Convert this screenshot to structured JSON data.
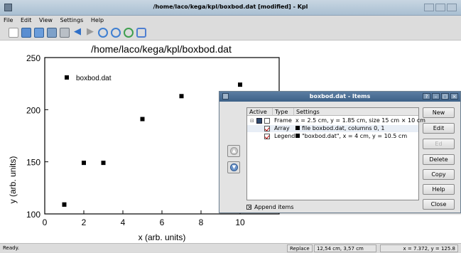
{
  "window": {
    "title": "/home/laco/kega/kpl/boxbod.dat [modified] - Kpl"
  },
  "menu": [
    "File",
    "Edit",
    "View",
    "Settings",
    "Help"
  ],
  "toolbar_icons": [
    "new-icon",
    "open-icon",
    "open-recent-icon",
    "save-icon",
    "print-icon",
    "back-icon",
    "forward-icon",
    "zoom-in-icon",
    "zoom-out-icon",
    "reload-icon",
    "fit-icon"
  ],
  "plot": {
    "chart_data": {
      "type": "scatter",
      "title": "/home/laco/kega/kpl/boxbod.dat",
      "xlabel": "x (arb. units)",
      "ylabel": "y (arb. units)",
      "xlim": [
        0,
        12
      ],
      "ylim": [
        100,
        250
      ],
      "xticks": [
        "0",
        "2",
        "4",
        "6",
        "8",
        "10"
      ],
      "yticks": [
        "100",
        "150",
        "200",
        "250"
      ],
      "legend": "boxbod.dat",
      "legend_position": "top-left",
      "series": [
        {
          "name": "boxbod.dat",
          "x": [
            1,
            1,
            2,
            3,
            5,
            7,
            10
          ],
          "y": [
            109,
            109,
            149,
            149,
            191,
            213,
            224
          ]
        }
      ]
    }
  },
  "dialog": {
    "title": "boxbod.dat - Items",
    "columns": [
      "Active",
      "Type",
      "Settings"
    ],
    "items": [
      {
        "type": "Frame",
        "settings": "x = 2.5 cm, y = 1.85 cm, size 15 cm × 10 cm"
      },
      {
        "type": "Array",
        "settings": "file boxbod.dat, columns 0, 1"
      },
      {
        "type": "Legend",
        "settings": "\"boxbod.dat\", x = 4 cm, y = 10.5 cm"
      }
    ],
    "buttons": {
      "new": "New",
      "edit": "Edit",
      "edit2": "Ed",
      "delete": "Delete",
      "copy": "Copy",
      "help": "Help",
      "close": "Close"
    },
    "append_label": "Append items"
  },
  "status": {
    "ready": "Ready.",
    "mode": "Replace",
    "position_cm": "12,54 cm,   3,57 cm",
    "coords": "x = 7.372,  y = 125.8"
  },
  "colors": {
    "titlebar": "#a9bfd2",
    "dialog_titlebar": "#3d6187",
    "accent": "#6b93c9"
  }
}
